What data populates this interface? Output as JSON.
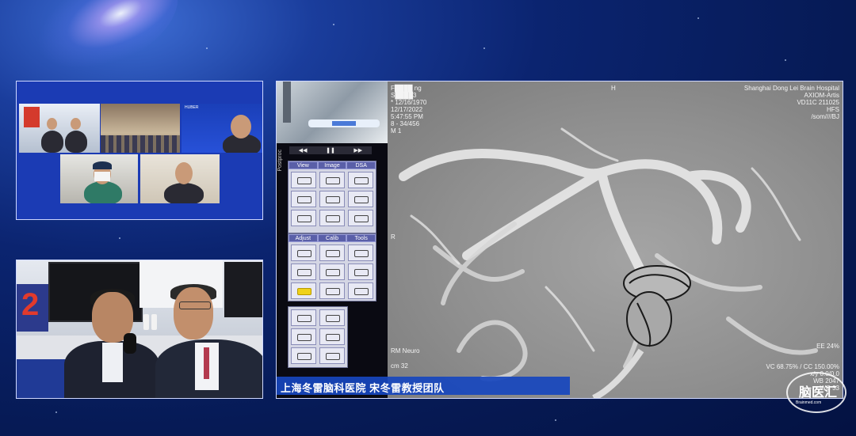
{
  "meeting_grid": {
    "banner_text": "HUBER"
  },
  "imaging": {
    "overlay_top_left": [
      "F████ ng",
      "S████3",
      "* 12/16/1970",
      "12/17/2022",
      "5:47:55 PM",
      "8 - 34/456",
      "M 1"
    ],
    "overlay_top_right": [
      "Shanghai Dong Lei Brain Hospital",
      "AXIOM-Artis",
      "VD11C 211025",
      "HFS",
      "/som////BJ"
    ],
    "orientation_top": "H",
    "orientation_left": "R",
    "overlay_bottom_left": [
      "RM Neuro",
      "cm 32"
    ],
    "overlay_ee": "EE 24%",
    "overlay_bottom_right": [
      "VC 68.75% / CC 150.00%",
      "x/y 0.0/0.0",
      "WB 2047",
      "WC 33"
    ],
    "caption": "上海冬雷脑科医院 宋冬雷教授团队"
  },
  "toolbar": {
    "side_label": "Postproc",
    "playback": [
      "◀◀",
      "❚❚",
      "▶▶"
    ],
    "tabs_top": [
      "View",
      "Image",
      "DSA"
    ],
    "tabs_mid": [
      "Adjust",
      "Calib",
      "Tools"
    ]
  },
  "logo": {
    "text": "脑医汇",
    "subtext": "Brainmed.com"
  },
  "colors": {
    "background": "#0b2470",
    "caption_bar": "#1746be",
    "panel_border": "#cfd8ff",
    "tool_tab": "#5a5fa8"
  }
}
